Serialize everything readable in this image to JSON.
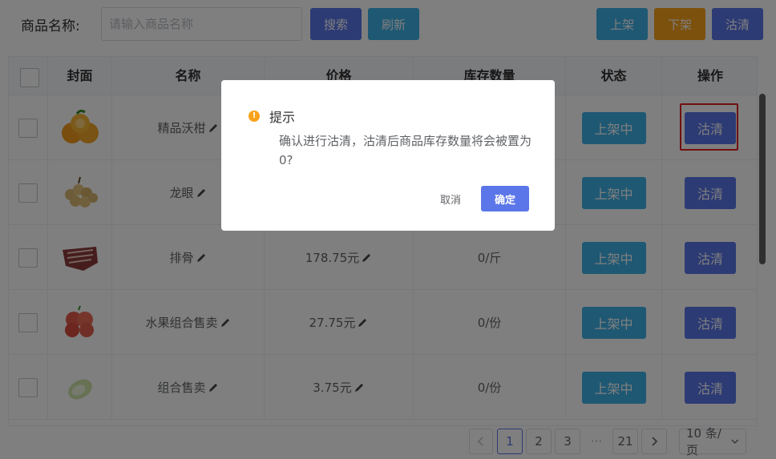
{
  "toolbar": {
    "name_label": "商品名称:",
    "name_placeholder": "请输入商品名称",
    "search_label": "搜索",
    "refresh_label": "刷新",
    "shelf_label": "上架",
    "unshelf_label": "下架",
    "clear_label": "沽清"
  },
  "table": {
    "headers": {
      "cover": "封面",
      "name": "名称",
      "price": "价格",
      "stock": "库存数量",
      "status": "状态",
      "action": "操作"
    },
    "rows": [
      {
        "name": "精品沃柑",
        "price": "",
        "stock": "",
        "status": "上架中",
        "action": "沽清",
        "cover_icon": "orange-image"
      },
      {
        "name": "龙眼",
        "price": "",
        "stock": "",
        "status": "上架中",
        "action": "沽清",
        "cover_icon": "longan-image"
      },
      {
        "name": "排骨",
        "price": "178.75元",
        "stock": "0/斤",
        "status": "上架中",
        "action": "沽清",
        "cover_icon": "ribs-image"
      },
      {
        "name": "水果组合售卖",
        "price": "27.75元",
        "stock": "0/份",
        "status": "上架中",
        "action": "沽清",
        "cover_icon": "apples-image"
      },
      {
        "name": "组合售卖",
        "price": "3.75元",
        "stock": "0/份",
        "status": "上架中",
        "action": "沽清",
        "cover_icon": "cabbage-image"
      }
    ]
  },
  "pagination": {
    "pages": [
      "1",
      "2",
      "3",
      "21"
    ],
    "ellipsis": "···",
    "current": "1",
    "page_size": "10 条/页"
  },
  "dialog": {
    "title": "提示",
    "icon": "!",
    "message": "确认进行沽清，沽清后商品库存数量将会被置为0?",
    "cancel_label": "取消",
    "confirm_label": "确定"
  },
  "colors": {
    "primary": "#5b76e8",
    "info": "#3eb1e6",
    "warning": "#f8a21b",
    "highlight": "#e02020"
  }
}
